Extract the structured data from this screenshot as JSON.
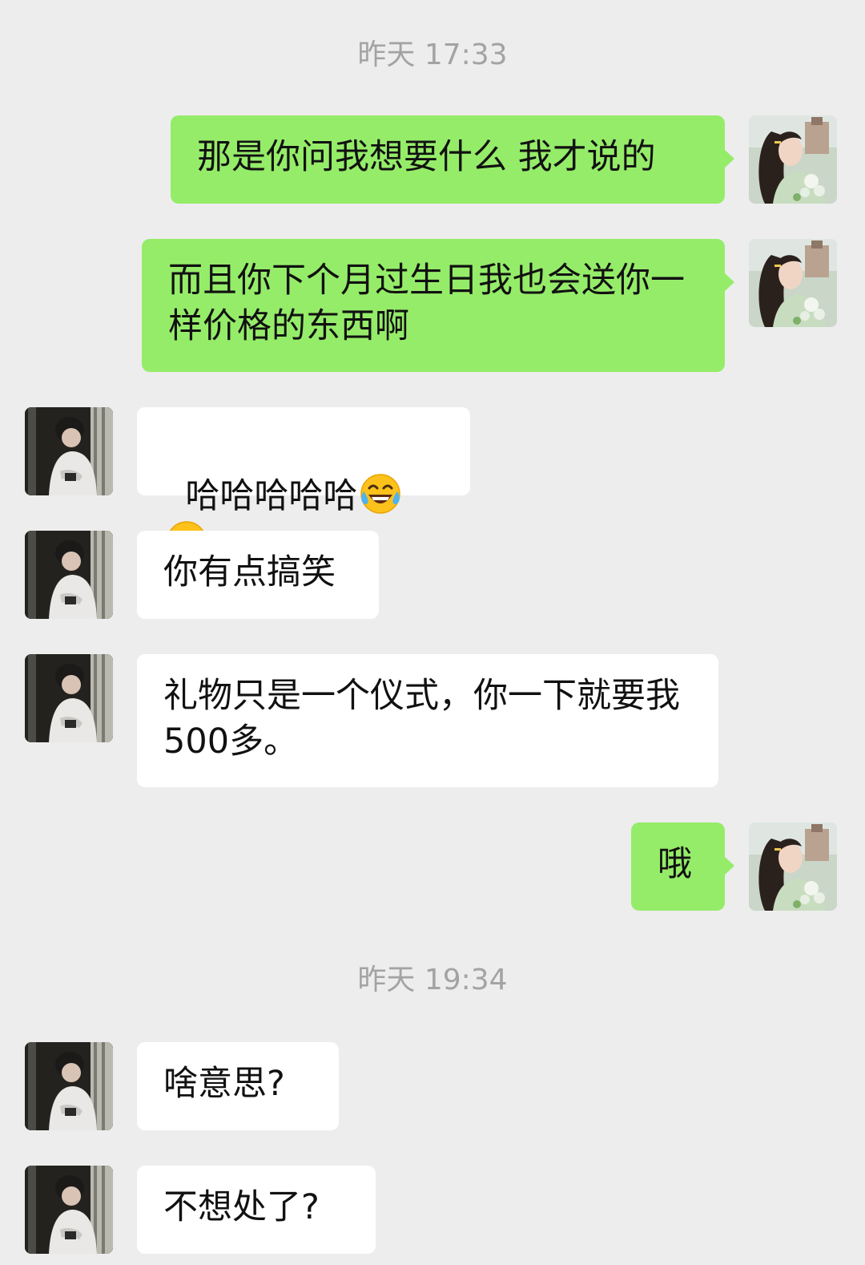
{
  "conversation": {
    "timestamps": [
      "昨天 17:33",
      "昨天 19:34"
    ],
    "messages": [
      {
        "sender": "self",
        "text": "那是你问我想要什么 我才说的"
      },
      {
        "sender": "self",
        "text": "而且你下个月过生日我也会送你一样价格的东西啊"
      },
      {
        "sender": "other",
        "text": "哈哈哈哈哈",
        "emoji": [
          "face-with-tears-of-joy",
          "face-with-tears-of-joy"
        ]
      },
      {
        "sender": "other",
        "text": "你有点搞笑"
      },
      {
        "sender": "other",
        "text": "礼物只是一个仪式，你一下就要我500多。"
      },
      {
        "sender": "self",
        "text": "哦"
      },
      {
        "sender": "other",
        "text": "啥意思?"
      },
      {
        "sender": "other",
        "text": "不想处了?"
      }
    ]
  },
  "colors": {
    "background": "#ededed",
    "self_bubble": "#95ec69",
    "other_bubble": "#ffffff",
    "timestamp": "#a3a3a3"
  }
}
